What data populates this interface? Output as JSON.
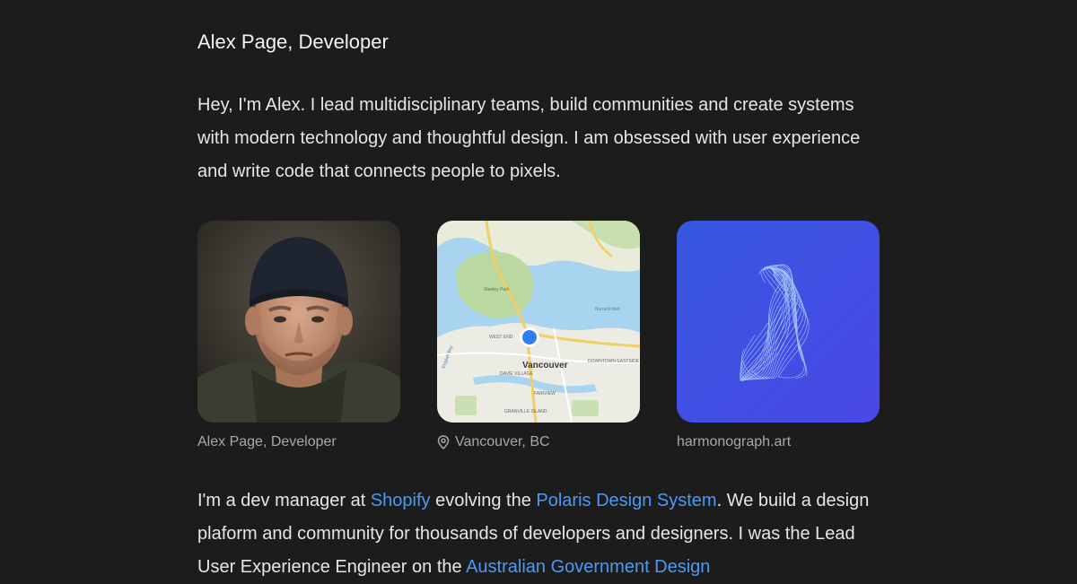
{
  "header": {
    "title": "Alex Page, Developer"
  },
  "intro": {
    "text": "Hey, I'm Alex. I lead multidisciplinary teams, build communities and create systems with modern technology and thoughtful design. I am obsessed with user experience and write code that connects people to pixels."
  },
  "tiles": [
    {
      "caption": "Alex Page, Developer",
      "image": "portrait-photo"
    },
    {
      "caption": "Vancouver, BC",
      "icon": "location-pin-icon",
      "image": "map-vancouver",
      "map_labels": {
        "city": "Vancouver",
        "west_end": "WEST END",
        "davie_village": "DAVIE VILLAGE",
        "downtown": "DOWNTOWN EASTSIDE",
        "stanley_park": "Stanley Park",
        "burrard_inlet": "Burrard Inlet",
        "english_bay": "English Bay",
        "granville_island": "GRANVILLE ISLAND",
        "fairview": "FAIRVIEW"
      }
    },
    {
      "caption": "harmonograph.art",
      "image": "harmonograph-art"
    }
  ],
  "bio": {
    "t1": "I'm a dev manager at ",
    "link_shopify": "Shopify",
    "t2": " evolving the ",
    "link_polaris": "Polaris Design System",
    "t3": ". We build a design plaform and community for thousands of developers and designers. I was the Lead User Experience Engineer on the ",
    "link_agds": "Australian Government Design"
  },
  "colors": {
    "background": "#1c1c1c",
    "text": "#e6e6e6",
    "muted": "#a8a8a8",
    "link": "#4a9af5",
    "harmonograph_bg": "#3f52e3"
  }
}
